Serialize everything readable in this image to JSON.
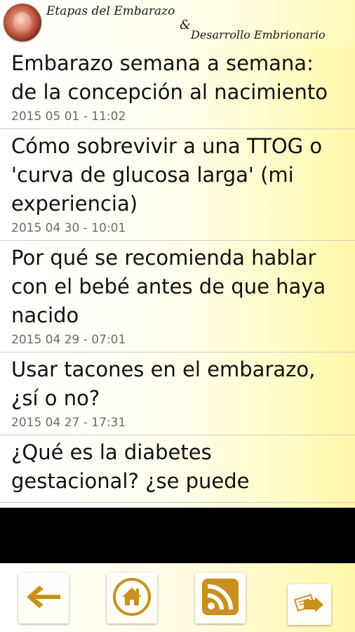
{
  "header": {
    "title_line1": "Etapas del Embarazo",
    "ampersand": "&",
    "title_line2": "Desarrollo Embrionario"
  },
  "articles": [
    {
      "title": "Embarazo semana a semana: de la concepción al nacimiento",
      "date": "2015 05 01 - 11:02"
    },
    {
      "title": "Cómo sobrevivir a una TTOG o 'curva de glucosa larga' (mi experiencia)",
      "date": "2015 04 30 - 10:01"
    },
    {
      "title": "Por qué se recomienda hablar con el bebé antes de que haya nacido",
      "date": "2015 04 29 - 07:01"
    },
    {
      "title": "Usar tacones en el embarazo, ¿sí o no?",
      "date": "2015 04 27 - 17:31"
    },
    {
      "title": "¿Qué es la diabetes gestacional? ¿se puede",
      "date": ""
    }
  ],
  "toolbar": {
    "icons": [
      "back-arrow-icon",
      "home-icon",
      "rss-icon",
      "share-icon"
    ],
    "accent_color": "#c8901c"
  }
}
